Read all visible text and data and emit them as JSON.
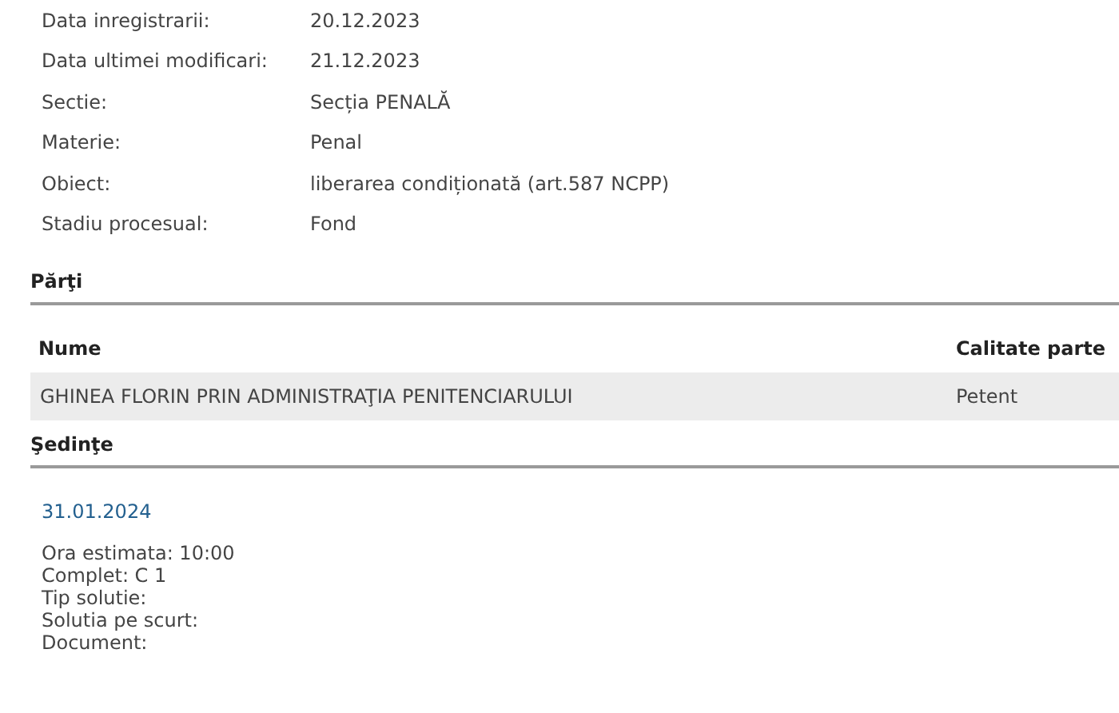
{
  "details": [
    {
      "label": "Data inregistrarii:",
      "value": "20.12.2023"
    },
    {
      "label": "Data ultimei modificari:",
      "value": "21.12.2023"
    },
    {
      "label": "Sectie:",
      "value": "Secția PENALĂ"
    },
    {
      "label": "Materie:",
      "value": "Penal"
    },
    {
      "label": "Obiect:",
      "value": "liberarea condiționată (art.587 NCPP)"
    },
    {
      "label": "Stadiu procesual:",
      "value": "Fond"
    }
  ],
  "parti": {
    "title": "Părţi",
    "columns": [
      "Nume",
      "Calitate parte"
    ],
    "rows": [
      [
        "GHINEA FLORIN PRIN ADMINISTRAŢIA PENITENCIARULUI",
        "Petent"
      ]
    ]
  },
  "sedinte": {
    "title": "Şedinţe",
    "items": [
      {
        "date": "31.01.2024",
        "lines": [
          "Ora estimata: 10:00",
          "Complet: C 1",
          "Tip solutie:",
          "Solutia pe scurt:",
          "Document:"
        ]
      }
    ]
  }
}
